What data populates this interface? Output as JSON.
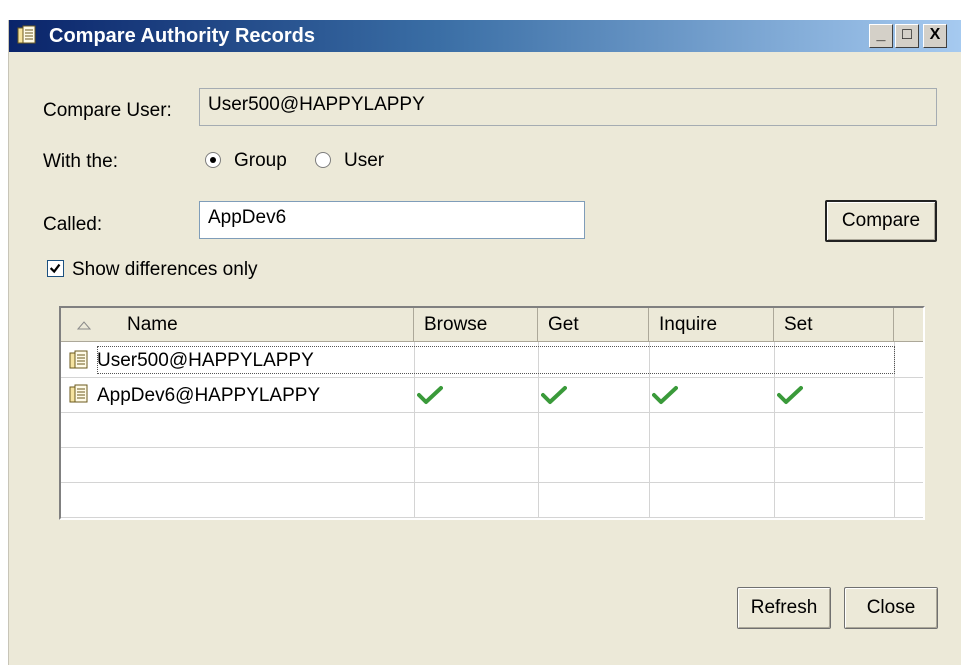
{
  "window": {
    "title": "Compare Authority Records",
    "minimize": "_",
    "maximize": "□",
    "close": "X"
  },
  "form": {
    "compare_user_label": "Compare User:",
    "compare_user_value": "User500@HAPPYLAPPY",
    "with_label": "With the:",
    "radio_group_label": "Group",
    "radio_user_label": "User",
    "radio_selected": "Group",
    "called_label": "Called:",
    "called_value": "AppDev6",
    "compare_button": "Compare",
    "show_diff_label": "Show differences only",
    "show_diff_checked": true
  },
  "table": {
    "columns": [
      "Name",
      "Browse",
      "Get",
      "Inquire",
      "Set"
    ],
    "sort_indicator": "ascending",
    "rows": [
      {
        "name": "User500@HAPPYLAPPY",
        "browse": false,
        "get": false,
        "inquire": false,
        "set": false
      },
      {
        "name": "AppDev6@HAPPYLAPPY",
        "browse": true,
        "get": true,
        "inquire": true,
        "set": true
      }
    ]
  },
  "buttons": {
    "refresh": "Refresh",
    "close": "Close"
  },
  "colors": {
    "titlebar_start": "#0a246a",
    "titlebar_end": "#a6caf0",
    "check": "#3a9a3a",
    "dialog_bg": "#ece9d8"
  }
}
